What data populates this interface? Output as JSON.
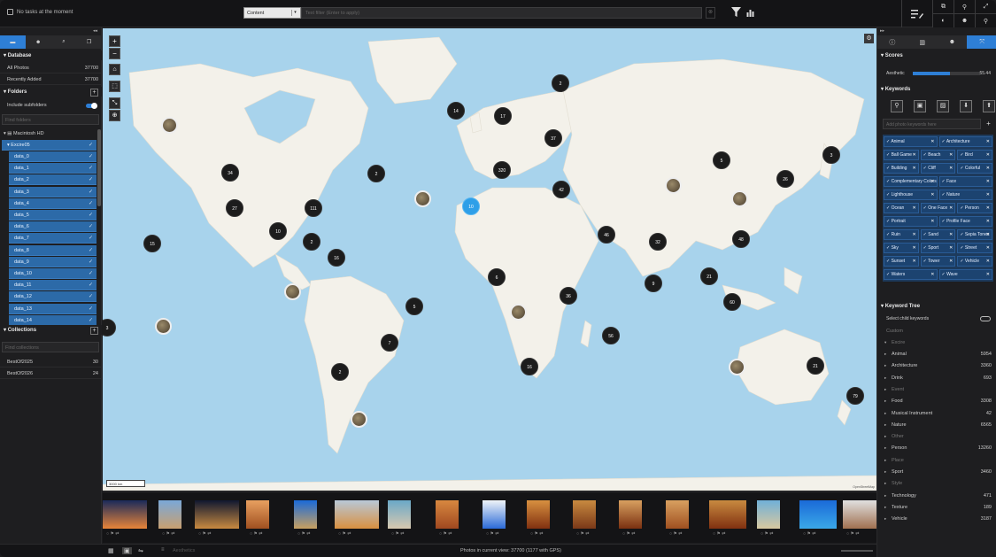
{
  "topbar": {
    "status": "No tasks at the moment",
    "filter_select": "Content",
    "filter_placeholder": "Text filter (Enter to apply)"
  },
  "left": {
    "database_title": "Database",
    "database_rows": [
      {
        "label": "All Photos",
        "value": "37700"
      },
      {
        "label": "Recently Added",
        "value": "37700"
      }
    ],
    "folders_title": "Folders",
    "include_subfolders": "Include subfolders",
    "find_folders": "Find folders",
    "drive": "Macintosh HD",
    "root_folder": "Excire05",
    "folders": [
      "data_0",
      "data_1",
      "data_2",
      "data_3",
      "data_4",
      "data_5",
      "data_6",
      "data_7",
      "data_8",
      "data_9",
      "data_10",
      "data_11",
      "data_12",
      "data_13",
      "data_14"
    ],
    "collections_title": "Collections",
    "find_collections": "Find collections",
    "collections": [
      {
        "label": "BestOf2025",
        "value": "30"
      },
      {
        "label": "BestOf2026",
        "value": "24"
      }
    ]
  },
  "map": {
    "clusters": [
      "2",
      "14",
      "17",
      "37",
      "320",
      "42",
      "5",
      "3",
      "34",
      "2",
      "27",
      "111",
      "10",
      "2",
      "15",
      "16",
      "10",
      "46",
      "32",
      "48",
      "26",
      "6",
      "9",
      "21",
      "60",
      "36",
      "5",
      "7",
      "56",
      "2",
      "16",
      "21",
      "79",
      "3"
    ],
    "scale_label": "3000 km",
    "attribution": "OpenStreetMap"
  },
  "bottombar": {
    "photos_in_view": "Photos in current view: 37700  (1177 with GPS)",
    "sort_label": "Aesthetics"
  },
  "right": {
    "scores_title": "Scores",
    "aesthetic_label": "Aesthetic",
    "aesthetic_value": "55.44",
    "aesthetic_fraction": 0.55,
    "keywords_title": "Keywords",
    "kw_placeholder": "Add photo keywords here",
    "keywords": [
      "Animal",
      "Architecture",
      "Ball Game",
      "Beach",
      "Bird",
      "Building",
      "Cliff",
      "Colorful",
      "Complementary Colors",
      "Face",
      "Lighthouse",
      "Nature",
      "Ocean",
      "One Face",
      "Person",
      "Portrait",
      "Profile Face",
      "Ruin",
      "Sand",
      "Sepia Tones",
      "Sky",
      "Sport",
      "Street",
      "Sunset",
      "Tower",
      "Vehicle",
      "Waters",
      "Wave"
    ],
    "tree_title": "Keyword Tree",
    "select_child": "Select child keywords",
    "custom": "Custom",
    "excire": "Excire",
    "tree": [
      {
        "label": "Animal",
        "value": "5954",
        "dim": false
      },
      {
        "label": "Architecture",
        "value": "3360",
        "dim": false
      },
      {
        "label": "Drink",
        "value": "693",
        "dim": false
      },
      {
        "label": "Event",
        "value": "",
        "dim": true
      },
      {
        "label": "Food",
        "value": "3308",
        "dim": false
      },
      {
        "label": "Musical Instrument",
        "value": "42",
        "dim": false
      },
      {
        "label": "Nature",
        "value": "6565",
        "dim": false
      },
      {
        "label": "Other",
        "value": "",
        "dim": true
      },
      {
        "label": "Person",
        "value": "13260",
        "dim": false
      },
      {
        "label": "Place",
        "value": "",
        "dim": true
      },
      {
        "label": "Sport",
        "value": "3460",
        "dim": false
      },
      {
        "label": "Style",
        "value": "",
        "dim": true
      },
      {
        "label": "Technology",
        "value": "471",
        "dim": false
      },
      {
        "label": "Texture",
        "value": "189",
        "dim": false
      },
      {
        "label": "Vehicle",
        "value": "3187",
        "dim": false
      }
    ]
  }
}
